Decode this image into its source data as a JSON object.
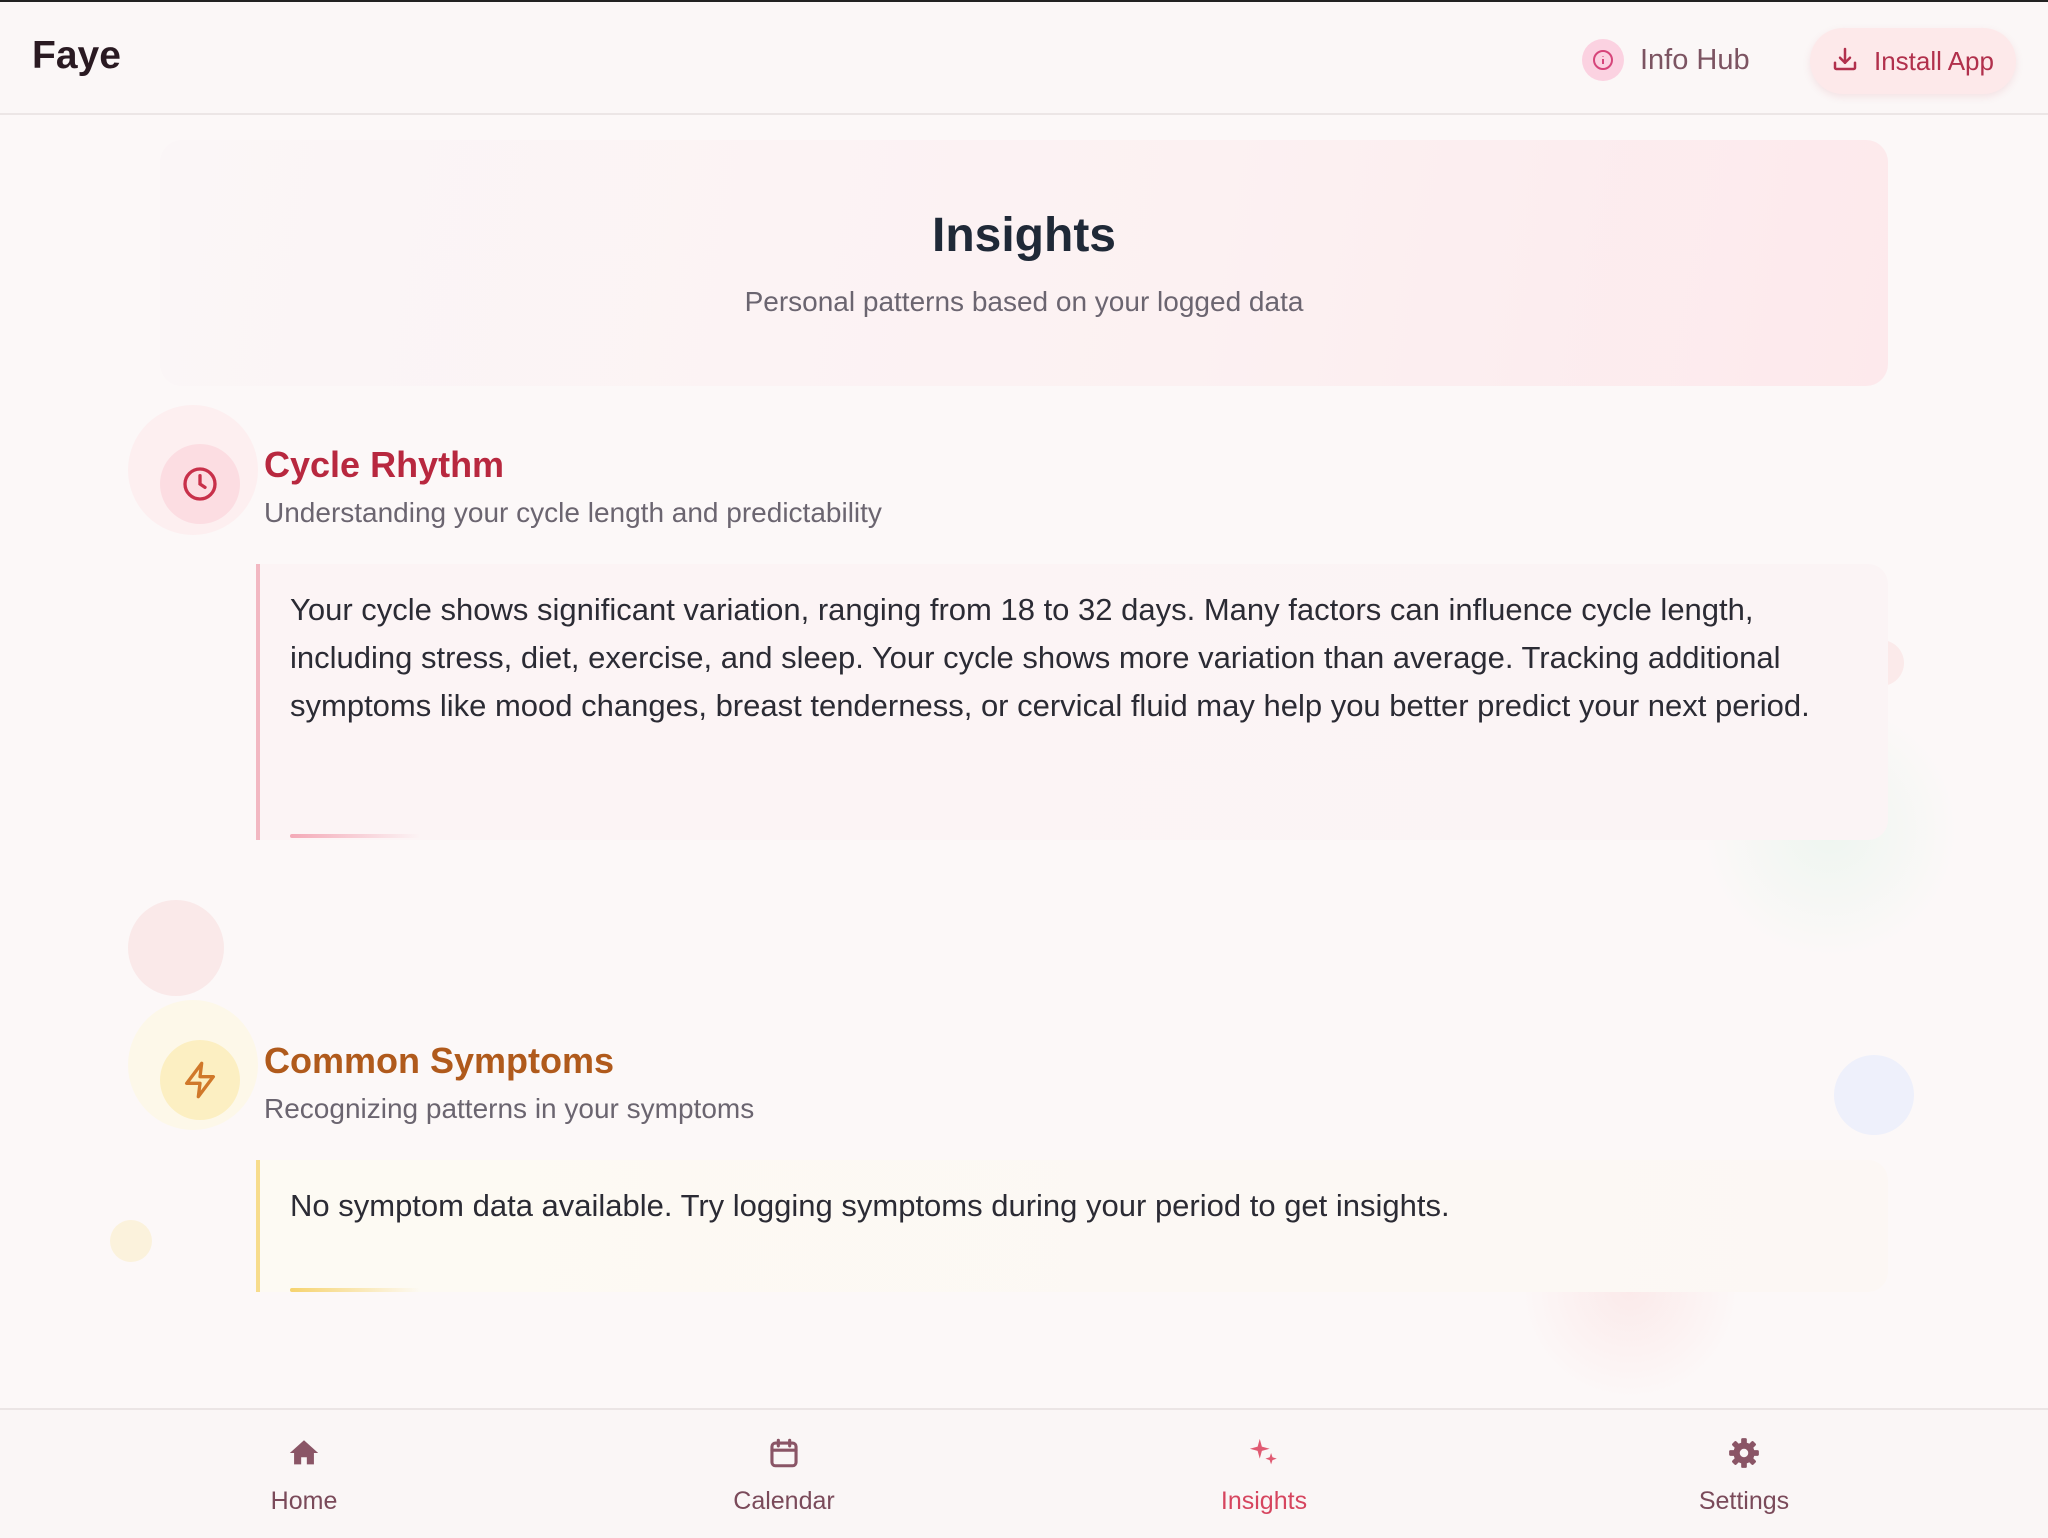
{
  "app": {
    "name": "Faye"
  },
  "header": {
    "info_hub_label": "Info Hub",
    "info_hub_icon": "info-circle-icon",
    "install_label": "Install App",
    "install_icon": "download-icon"
  },
  "page": {
    "title": "Insights",
    "subtitle": "Personal patterns based on your logged data"
  },
  "sections": [
    {
      "title": "Cycle Rhythm",
      "subtitle": "Understanding your cycle length and predictability",
      "icon": "clock-icon",
      "accent": "#b8283f",
      "body": "Your cycle shows significant variation, ranging from 18 to 32 days. Many factors can influence cycle length, including stress, diet, exercise, and sleep. Your cycle shows more variation than average. Tracking additional symptoms like mood changes, breast tenderness, or cervical fluid may help you better predict your next period."
    },
    {
      "title": "Common Symptoms",
      "subtitle": "Recognizing patterns in your symptoms",
      "icon": "lightning-icon",
      "accent": "#b05a1c",
      "body": "No symptom data available. Try logging symptoms during your period to get insights."
    }
  ],
  "nav": {
    "items": [
      {
        "label": "Home",
        "icon": "home-icon",
        "active": false
      },
      {
        "label": "Calendar",
        "icon": "calendar-icon",
        "active": false
      },
      {
        "label": "Insights",
        "icon": "sparkles-icon",
        "active": true
      },
      {
        "label": "Settings",
        "icon": "gear-icon",
        "active": false
      }
    ],
    "colors": {
      "inactive": "#7a4a5a",
      "active": "#d6455f"
    }
  }
}
